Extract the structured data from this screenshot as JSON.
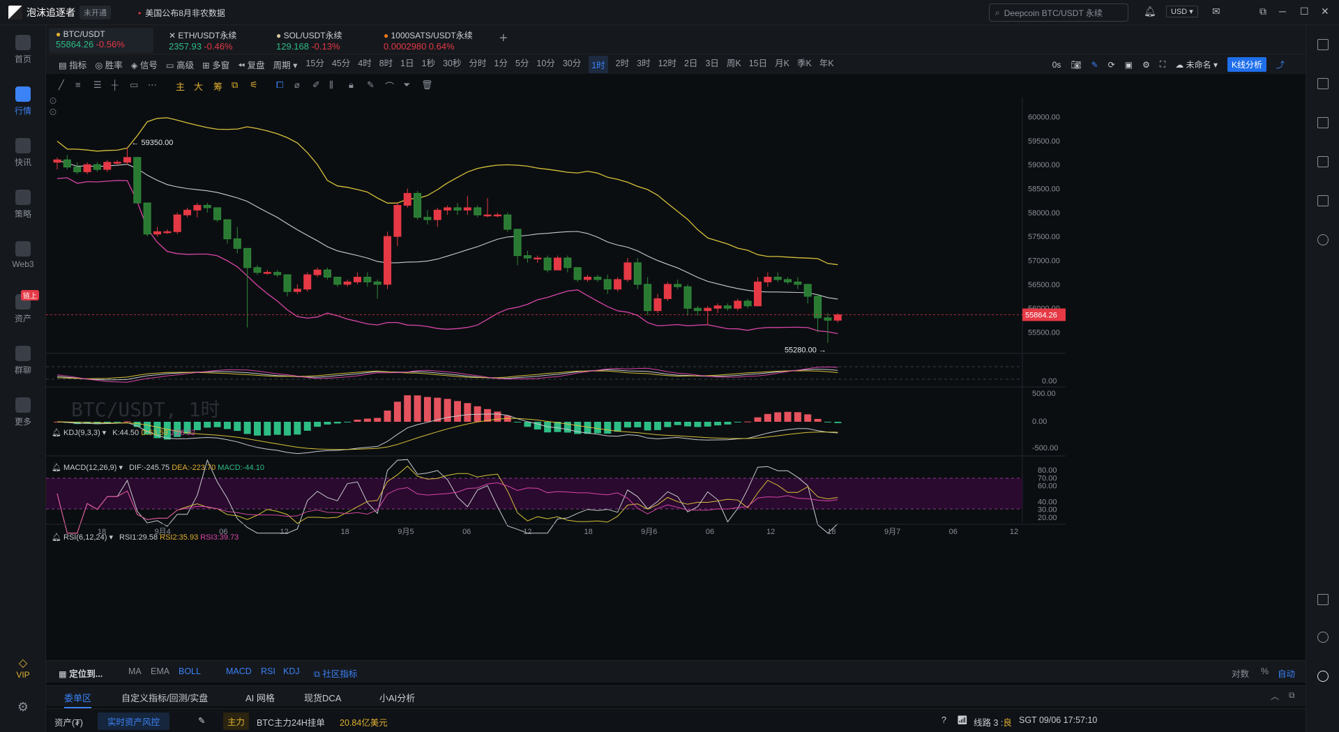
{
  "app": {
    "name": "泡沫追逐者",
    "status_pill": "未开通",
    "news": "美国公布8月非农数据",
    "search_placeholder": "Deepcoin BTC/USDT 永续",
    "currency": "USD"
  },
  "sidebar": {
    "items": [
      {
        "label": "首页",
        "icon": "home-icon"
      },
      {
        "label": "行情",
        "icon": "market-chart-icon"
      },
      {
        "label": "快讯",
        "icon": "news-icon"
      },
      {
        "label": "策略",
        "icon": "strategy-robot-icon"
      },
      {
        "label": "Web3",
        "icon": "web3-icon"
      },
      {
        "label": "资产",
        "icon": "wallet-icon",
        "badge": "链上"
      },
      {
        "label": "群聊",
        "icon": "chat-icon"
      },
      {
        "label": "更多",
        "icon": "more-grid-icon"
      }
    ],
    "vip": "VIP"
  },
  "tabs": [
    {
      "name": "BTC/USDT",
      "price": "55864.26",
      "change": "-0.56%"
    },
    {
      "name": "ETH/USDT永续",
      "price": "2357.93",
      "change": "-0.46%"
    },
    {
      "name": "SOL/USDT永续",
      "price": "129.168",
      "change": "-0.13%"
    },
    {
      "name": "1000SATS/USDT永续",
      "price": "0.0002980",
      "change": "0.64%"
    }
  ],
  "toolbar": {
    "indicator": "指标",
    "win_rate": "胜率",
    "signal": "信号",
    "advanced": "高级",
    "multi_window": "多窗",
    "replay": "复盘",
    "period": "周期",
    "intervals": [
      "15分",
      "45分",
      "4时",
      "8时",
      "1日",
      "1秒",
      "30秒",
      "分时",
      "1分",
      "5分",
      "10分",
      "30分",
      "1时",
      "2时",
      "3时",
      "12时",
      "2日",
      "3日",
      "周K",
      "15日",
      "月K",
      "季K",
      "年K"
    ],
    "active_interval": "1时",
    "countdown": "0s",
    "layout_name": "未命名",
    "k_analysis": "K线分析"
  },
  "drawbar": {
    "main": "主",
    "big": "大",
    "chips": "筹"
  },
  "chart_data": {
    "type": "candlestick",
    "symbol_watermark": "BTC/USDT, 1时",
    "y_ticks": [
      "60000.00",
      "59500.00",
      "59000.00",
      "58500.00",
      "58000.00",
      "57500.00",
      "57000.00",
      "56500.00",
      "56000.00",
      "55500.00"
    ],
    "ylim": [
      55100,
      60400
    ],
    "x_ticks": [
      "18",
      "9月4",
      "06",
      "12",
      "18",
      "9月5",
      "06",
      "12",
      "18",
      "9月6",
      "06",
      "12",
      "18",
      "9月7",
      "06",
      "12"
    ],
    "last_price": "55864.26",
    "high_marker": "59350.00",
    "low_marker": "55280.00",
    "ohlc": [
      [
        59050,
        59150,
        58900,
        59100
      ],
      [
        59100,
        59200,
        58900,
        58950
      ],
      [
        58950,
        59050,
        58800,
        58850
      ],
      [
        58850,
        59050,
        58800,
        59000
      ],
      [
        59000,
        59050,
        58850,
        58900
      ],
      [
        58900,
        59100,
        58850,
        59050
      ],
      [
        59050,
        59100,
        59000,
        59050
      ],
      [
        59050,
        59350,
        59000,
        59150
      ],
      [
        59150,
        59150,
        58200,
        58200
      ],
      [
        58200,
        58200,
        57500,
        57550
      ],
      [
        57550,
        57700,
        57500,
        57600
      ],
      [
        57600,
        57650,
        57550,
        57600
      ],
      [
        57600,
        58000,
        57550,
        57950
      ],
      [
        57950,
        58100,
        57900,
        58050
      ],
      [
        58050,
        58200,
        57900,
        58150
      ],
      [
        58150,
        58200,
        58000,
        58100
      ],
      [
        58100,
        58100,
        57800,
        57850
      ],
      [
        57850,
        57850,
        57350,
        57450
      ],
      [
        57450,
        57700,
        57150,
        57250
      ],
      [
        57250,
        57250,
        55600,
        56850
      ],
      [
        56850,
        56900,
        56700,
        56750
      ],
      [
        56750,
        56800,
        56700,
        56750
      ],
      [
        56750,
        56800,
        56650,
        56700
      ],
      [
        56700,
        56700,
        56250,
        56350
      ],
      [
        56350,
        56500,
        56300,
        56400
      ],
      [
        56400,
        56750,
        56350,
        56700
      ],
      [
        56700,
        56850,
        56650,
        56800
      ],
      [
        56800,
        56850,
        56600,
        56650
      ],
      [
        56650,
        56650,
        56450,
        56500
      ],
      [
        56500,
        56600,
        56450,
        56550
      ],
      [
        56550,
        56750,
        56500,
        56650
      ],
      [
        56650,
        56750,
        56450,
        56550
      ],
      [
        56550,
        56600,
        56200,
        56500
      ],
      [
        56500,
        57600,
        56400,
        57500
      ],
      [
        57500,
        58200,
        57300,
        58150
      ],
      [
        58150,
        58500,
        58100,
        58400
      ],
      [
        58400,
        58450,
        57850,
        57900
      ],
      [
        57900,
        58050,
        57750,
        57850
      ],
      [
        57850,
        58100,
        57700,
        58050
      ],
      [
        58050,
        58150,
        57950,
        58100
      ],
      [
        58100,
        58200,
        57950,
        58050
      ],
      [
        58050,
        58350,
        57950,
        58100
      ],
      [
        58100,
        58150,
        57900,
        57950
      ],
      [
        57950,
        58300,
        57900,
        57950
      ],
      [
        57950,
        58000,
        57900,
        57950
      ],
      [
        57950,
        58000,
        57600,
        57650
      ],
      [
        57650,
        57650,
        56900,
        57100
      ],
      [
        57100,
        57200,
        56950,
        57050
      ],
      [
        57050,
        57100,
        56950,
        57050
      ],
      [
        57050,
        57100,
        56750,
        56800
      ],
      [
        56800,
        57100,
        56800,
        57050
      ],
      [
        57050,
        57100,
        56750,
        56850
      ],
      [
        56850,
        56850,
        56550,
        56600
      ],
      [
        56600,
        56700,
        56550,
        56650
      ],
      [
        56650,
        56700,
        56550,
        56600
      ],
      [
        56600,
        56700,
        56300,
        56400
      ],
      [
        56400,
        56650,
        56350,
        56600
      ],
      [
        56600,
        57050,
        56550,
        56950
      ],
      [
        56950,
        57050,
        56400,
        56500
      ],
      [
        56500,
        56650,
        55850,
        55950
      ],
      [
        55950,
        56300,
        55900,
        56200
      ],
      [
        56200,
        56550,
        56150,
        56500
      ],
      [
        56500,
        56600,
        56400,
        56450
      ],
      [
        56450,
        56500,
        55850,
        56000
      ],
      [
        56000,
        56050,
        55850,
        55950
      ],
      [
        55950,
        56050,
        55650,
        56000
      ],
      [
        56000,
        56100,
        55900,
        56050
      ],
      [
        56050,
        56100,
        55950,
        56000
      ],
      [
        56000,
        56200,
        55950,
        56150
      ],
      [
        56150,
        56200,
        56000,
        56050
      ],
      [
        56050,
        56650,
        56050,
        56550
      ],
      [
        56550,
        56750,
        56450,
        56650
      ],
      [
        56650,
        56750,
        56550,
        56600
      ],
      [
        56600,
        56650,
        56500,
        56550
      ],
      [
        56550,
        56650,
        56400,
        56500
      ],
      [
        56500,
        56500,
        56100,
        56250
      ],
      [
        56250,
        56300,
        55500,
        55800
      ],
      [
        55800,
        55900,
        55280,
        55750
      ],
      [
        55750,
        55900,
        55700,
        55864
      ]
    ],
    "kdj": {
      "label": "KDJ(9,3,3)",
      "K": "K:44.50",
      "D": "D:53.59",
      "J": "J:26.32",
      "tick": "0.00"
    },
    "macd": {
      "label": "MACD(12,26,9)",
      "DIF": "DIF:-245.75",
      "DEA": "DEA:-223.70",
      "MACD": "MACD:-44.10",
      "ticks": [
        "500.00",
        "0.00",
        "-500.00"
      ]
    },
    "rsi": {
      "label": "RSI(6,12,24)",
      "RSI1": "RSI1:29.58",
      "RSI2": "RSI2:35.93",
      "RSI3": "RSI3:39.73",
      "ticks": [
        "80.00",
        "70.00",
        "60.00",
        "40.00",
        "30.00",
        "20.00"
      ]
    }
  },
  "indicator_bar": {
    "locate": "定位到...",
    "items": [
      "MA",
      "EMA",
      "BOLL",
      "MACD",
      "RSI",
      "KDJ"
    ],
    "community": "社区指标",
    "right": [
      "对数",
      "%",
      "自动"
    ]
  },
  "panel_tabs": [
    "委单区",
    "自定义指标/回测/实盘",
    "AI 网格",
    "现货DCA",
    "小AI分析"
  ],
  "status": {
    "asset": "资产(₮)",
    "risk": "实时资产风控",
    "main_tag": "主力",
    "flow_text": "BTC主力24H挂单",
    "flow_value": "20.84亿美元",
    "line": "线路 3 :",
    "line_quality": "良",
    "time": "SGT  09/06 17:57:10"
  }
}
